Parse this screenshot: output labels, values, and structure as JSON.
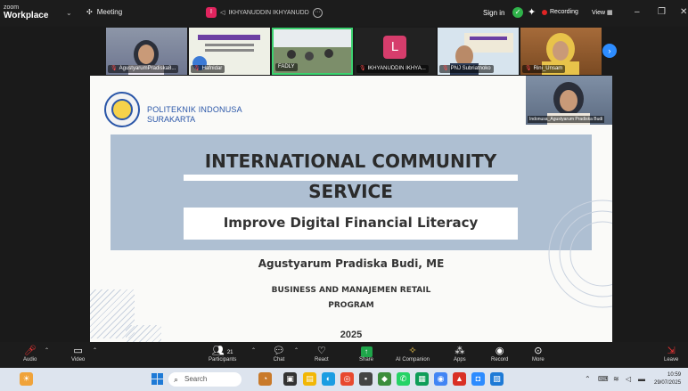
{
  "titlebar": {
    "logo_top": "zoom",
    "logo_bottom": "Workplace",
    "meeting_label": "Meeting",
    "host_name": "IKHYANUDDIN IKHYANUDD",
    "signin": "Sign in",
    "recording": "Recording",
    "view": "View"
  },
  "gallery": [
    {
      "name": "AgustyarumPradiska8..."
    },
    {
      "name": "Hafnidar"
    },
    {
      "name": "FADLY"
    },
    {
      "name": "IKHYANUDDIN IKHYA...",
      "initial": "L"
    },
    {
      "name": "PNJ Subriatnoko"
    },
    {
      "name": "Rini_Unsam"
    }
  ],
  "slide": {
    "org_line1": "POLITEKNIK INDONUSA",
    "org_line2": "SURAKARTA",
    "title_line1": "INTERNATIONAL COMMUNITY",
    "title_line2": "SERVICE",
    "subtitle": "Improve Digital Financial Literacy",
    "presenter": "Agustyarum Pradiska Budi, ME",
    "program_line1": "BUSINESS AND MANAJEMEN RETAIL",
    "program_line2": "PROGRAM",
    "year": "2025"
  },
  "selfview": {
    "name": "Indonusa_Agustyarum Pradiska Budi"
  },
  "toolbar": {
    "audio": "Audio",
    "video": "Video",
    "participants": "Participants",
    "participants_count": "21",
    "chat": "Chat",
    "react": "React",
    "share": "Share",
    "ai": "AI Companion",
    "apps": "Apps",
    "record": "Record",
    "more": "More",
    "leave": "Leave"
  },
  "taskbar": {
    "search_placeholder": "Search",
    "time": "10:59",
    "date": "29/07/2025"
  }
}
